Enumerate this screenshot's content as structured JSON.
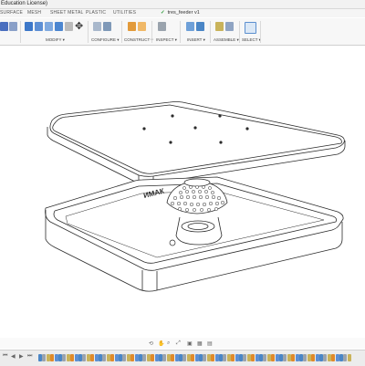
{
  "window": {
    "title": "Education License)"
  },
  "tabs": [
    {
      "label": "SURFACE"
    },
    {
      "label": "MESH"
    },
    {
      "label": "SHEET METAL"
    },
    {
      "label": "PLASTIC"
    },
    {
      "label": "UTILITIES"
    }
  ],
  "document": {
    "name": "tres_feeder v1",
    "saved_icon": "check-icon"
  },
  "toolbar": {
    "groups": [
      {
        "label": "MODIFY ▾"
      },
      {
        "label": "CONFIGURE ▾"
      },
      {
        "label": "CONSTRUCT ▾"
      },
      {
        "label": "INSPECT ▾"
      },
      {
        "label": "INSERT ▾"
      },
      {
        "label": "ASSEMBLE ▾"
      },
      {
        "label": "SELECT ▾"
      }
    ]
  },
  "model": {
    "engraving": "ИМАК"
  },
  "colors": {
    "accent": "#2a7dd1",
    "green": "#2e9a3a",
    "orange": "#e08a2a"
  }
}
